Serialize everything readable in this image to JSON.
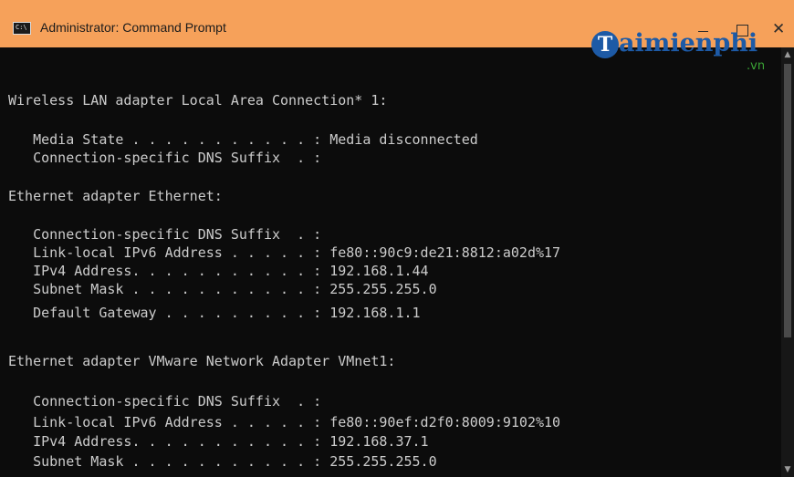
{
  "window": {
    "title": "Administrator: Command Prompt",
    "icon_label": "C:\\",
    "controls": {
      "minimize": "minimize-icon",
      "maximize": "maximize-icon",
      "close": "close-icon"
    }
  },
  "watermark": {
    "initial": "T",
    "name": "aimienphi",
    "suffix": ".vn"
  },
  "console": {
    "lines": [
      "",
      "Wireless LAN adapter Local Area Connection* 1:",
      "",
      "   Media State . . . . . . . . . . . : Media disconnected",
      "   Connection-specific DNS Suffix  . :",
      "",
      "Ethernet adapter Ethernet:",
      "",
      "   Connection-specific DNS Suffix  . :",
      "   Link-local IPv6 Address . . . . . : fe80::90c9:de21:8812:a02d%17",
      "   IPv4 Address. . . . . . . . . . . : 192.168.1.44",
      "   Subnet Mask . . . . . . . . . . . : 255.255.255.0",
      "   Default Gateway . . . . . . . . . : 192.168.1.1",
      "",
      "Ethernet adapter VMware Network Adapter VMnet1:",
      "",
      "   Connection-specific DNS Suffix  . :",
      "   Link-local IPv6 Address . . . . . : fe80::90ef:d2f0:8009:9102%10",
      "   IPv4 Address. . . . . . . . . . . : 192.168.37.1",
      "   Subnet Mask . . . . . . . . . . . : 255.255.255.0"
    ]
  },
  "colors": {
    "titlebar": "#f6a15a",
    "console_background": "#0c0c0c",
    "console_text": "#cccccc",
    "watermark_blue": "#1d5aa6",
    "watermark_green": "#3aa335"
  }
}
